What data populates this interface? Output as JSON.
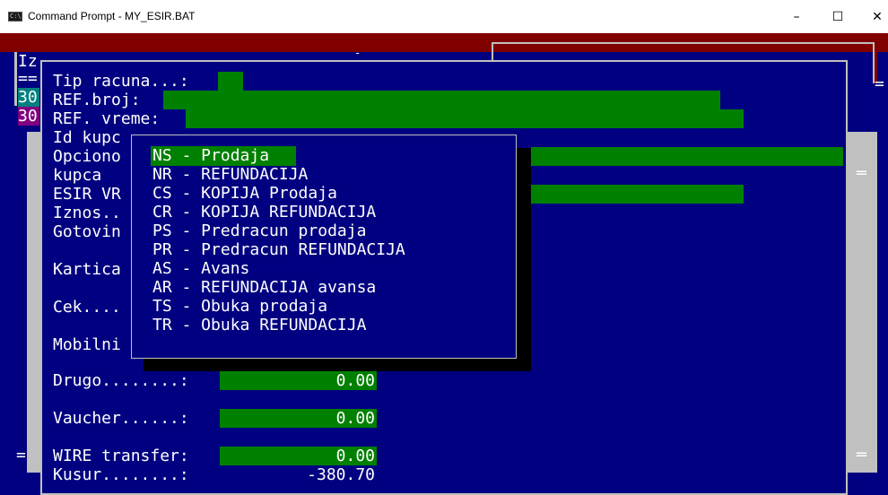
{
  "window": {
    "title": "Command Prompt - MY_ESIR.BAT",
    "icon_text": "C:\\",
    "minimize": "–",
    "maximize": "☐",
    "close": "✕"
  },
  "background": {
    "title_fragment": "Iz",
    "equals_left": "==",
    "row1_num": "30",
    "row2_num": "30",
    "dash_mid": "-",
    "right_equals_top": "=",
    "right_equals_mid": "═",
    "left_equals_bottom": "=",
    "right_equals_bottom": "═"
  },
  "form": {
    "tip_racuna_label": "Tip racuna...:",
    "ref_broj_label": "REF.broj:",
    "ref_vreme_label": "REF. vreme:",
    "id_kupca_label": "Id kupc",
    "opciono_label": "Opciono",
    "kupca_label": "kupca",
    "esir_vr_label": "ESIR VR",
    "iznos_label": "Iznos..",
    "gotovina_label": "Gotovin",
    "kartica_label": "Kartica",
    "cek_label": "Cek....",
    "mobilni_label": "Mobilni",
    "drugo_label": "Drugo........:",
    "drugo_value": "0.00",
    "vaucher_label": "Vaucher......:",
    "vaucher_value": "0.00",
    "wire_label": "WIRE transfer:",
    "wire_value": "0.00",
    "kusur_label": "Kusur........:",
    "kusur_value": "-380.70"
  },
  "dropdown": {
    "options": [
      "NS - Prodaja",
      "NR - REFUNDACIJA",
      "CS - KOPIJA Prodaja",
      "CR - KOPIJA REFUNDACIJA",
      "PS - Predracun prodaja",
      "PR - Predracun REFUNDACIJA",
      "AS - Avans",
      "AR - REFUNDACIJA avansa",
      "TS - Obuka prodaja",
      "TR - Obuka REFUNDACIJA"
    ],
    "selected_index": 0
  },
  "colors": {
    "console_blue": "#000080",
    "console_red": "#800000",
    "field_green": "#008000",
    "frame_gray": "#c0c0c0"
  }
}
